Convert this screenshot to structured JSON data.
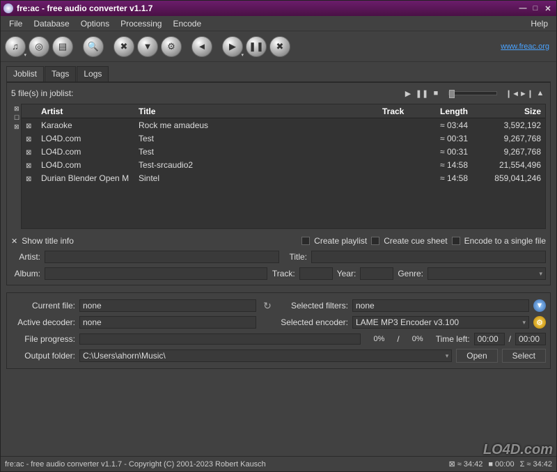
{
  "window": {
    "title": "fre:ac - free audio converter v1.1.7"
  },
  "menu": {
    "file": "File",
    "database": "Database",
    "options": "Options",
    "processing": "Processing",
    "encode": "Encode",
    "help": "Help"
  },
  "toolbar": {
    "link": "www.freac.org"
  },
  "tabs": {
    "joblist": "Joblist",
    "tags": "Tags",
    "logs": "Logs"
  },
  "joblist": {
    "count_label": "5 file(s) in joblist:",
    "columns": {
      "artist": "Artist",
      "title": "Title",
      "track": "Track",
      "length": "Length",
      "size": "Size"
    },
    "rows": [
      {
        "artist": "Karaoke",
        "title": "Rock me amadeus",
        "track": "",
        "length": "≈ 03:44",
        "size": "3,592,192"
      },
      {
        "artist": "LO4D.com",
        "title": "Test",
        "track": "",
        "length": "≈ 00:31",
        "size": "9,267,768"
      },
      {
        "artist": "LO4D.com",
        "title": "Test",
        "track": "",
        "length": "≈ 00:31",
        "size": "9,267,768"
      },
      {
        "artist": "LO4D.com",
        "title": "Test-srcaudio2",
        "track": "",
        "length": "≈ 14:58",
        "size": "21,554,496"
      },
      {
        "artist": "Durian Blender Open M",
        "title": "Sintel",
        "track": "",
        "length": "≈ 14:58",
        "size": "859,041,246"
      }
    ]
  },
  "options": {
    "show_title_info": "Show title info",
    "create_playlist": "Create playlist",
    "create_cue": "Create cue sheet",
    "encode_single": "Encode to a single file"
  },
  "info": {
    "artist_label": "Artist:",
    "artist": "",
    "title_label": "Title:",
    "title": "",
    "album_label": "Album:",
    "album": "",
    "track_label": "Track:",
    "track": "",
    "year_label": "Year:",
    "year": "",
    "genre_label": "Genre:",
    "genre": ""
  },
  "status": {
    "current_file_label": "Current file:",
    "current_file": "none",
    "selected_filters_label": "Selected filters:",
    "selected_filters": "none",
    "active_decoder_label": "Active decoder:",
    "active_decoder": "none",
    "selected_encoder_label": "Selected encoder:",
    "selected_encoder": "LAME MP3 Encoder v3.100",
    "file_progress_label": "File progress:",
    "pct1": "0%",
    "pct2": "0%",
    "time_left_label": "Time left:",
    "time_left1": "00:00",
    "time_left2": "00:00",
    "output_folder_label": "Output folder:",
    "output_folder": "C:\\Users\\ahorn\\Music\\",
    "open": "Open",
    "select": "Select",
    "slash": "/"
  },
  "footer": {
    "text": "fre:ac - free audio converter v1.1.7 - Copyright (C) 2001-2023 Robert Kausch",
    "total_len": "≈ 34:42",
    "total_time": "00:00",
    "total_len2": "≈ 34:42"
  },
  "watermark": "LO4D.com"
}
